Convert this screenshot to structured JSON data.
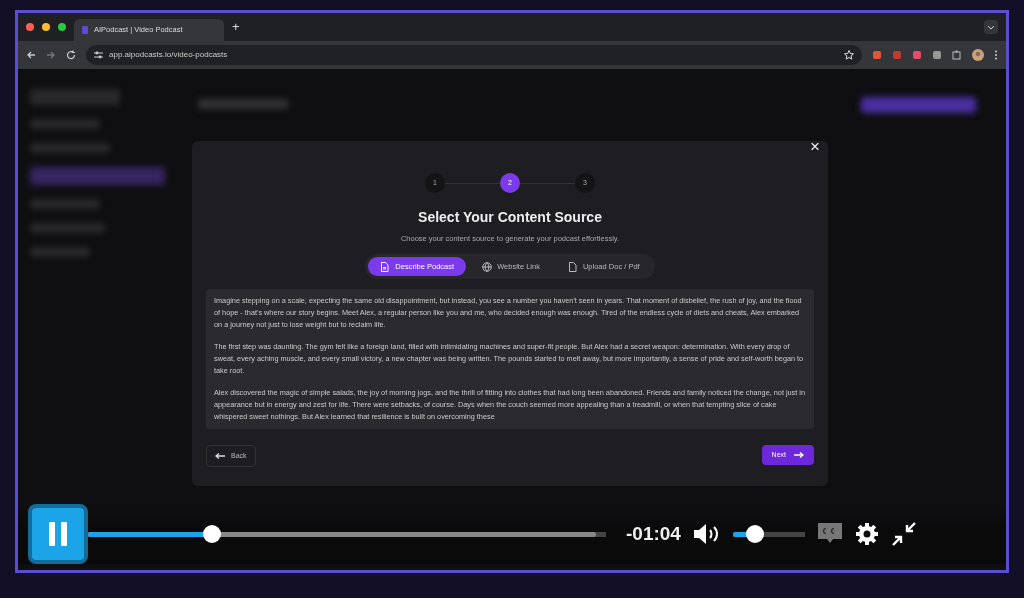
{
  "browser": {
    "tabs": [
      {
        "title": "AIPodcast | Video Podcast",
        "selected": true
      }
    ],
    "new_tab": "+",
    "url": "app.aipodcasts.io/video-podcasts"
  },
  "modal": {
    "close": "×",
    "steps": [
      {
        "label": "1",
        "selected": false
      },
      {
        "label": "2",
        "selected": true
      },
      {
        "label": "3",
        "selected": false
      }
    ],
    "title": "Select Your Content Source",
    "subtitle": "Choose your content source to generate your podcast effortlessly.",
    "sources": [
      {
        "label": "Describe Podcast",
        "kind": "document",
        "selected": true
      },
      {
        "label": "Website Link",
        "kind": "globe",
        "selected": false
      },
      {
        "label": "Upload Doc / Pdf",
        "kind": "file",
        "selected": false
      }
    ],
    "paragraphs": [
      "Imagine stepping on a scale, expecting the same old disappointment, but instead, you see a number you haven't seen in years. That moment of disbelief, the rush of joy, and the flood of hope - that's where our story begins. Meet Alex, a regular person like you and me, who decided enough was enough. Tired of the endless cycle of diets and cheats, Alex embarked on a journey not just to lose weight but to reclaim life.",
      "The first step was daunting. The gym felt like a foreign land, filled with intimidating machines and super-fit people. But Alex had a secret weapon: determination. With every drop of sweat, every aching muscle, and every small victory, a new chapter was being written. The pounds started to melt away, but more importantly, a sense of pride and self-worth began to take root.",
      "Alex discovered the magic of simple salads, the joy of morning jogs, and the thrill of fitting into clothes that had long been abandoned. Friends and family noticed the change, not just in appearance but in energy and zest for life. There were setbacks, of course. Days when the couch seemed more appealing than a treadmill, or when that tempting slice of cake whispered sweet nothings. But Alex learned that resilience is built on overcoming these"
    ],
    "back": "Back",
    "next": "Next"
  },
  "player": {
    "playing": true,
    "progress": {
      "level": 0.24
    },
    "buffered": {
      "level": 0.98
    },
    "time": "-01:04",
    "volume": {
      "level": 0.3
    }
  }
}
